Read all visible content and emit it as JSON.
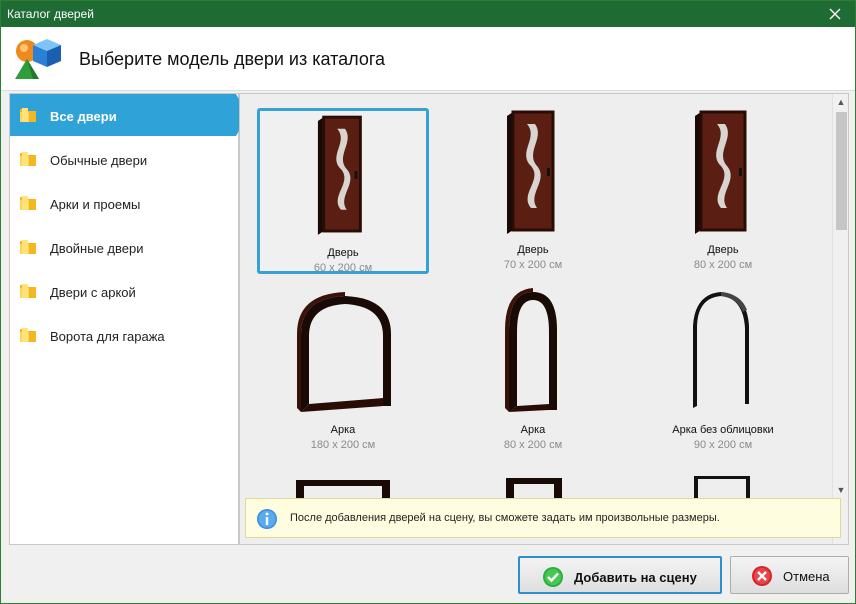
{
  "window": {
    "title": "Каталог дверей"
  },
  "header": {
    "title": "Выберите модель двери из каталога"
  },
  "sidebar": {
    "items": [
      {
        "label": "Все двери",
        "active": true
      },
      {
        "label": "Обычные двери"
      },
      {
        "label": "Арки и проемы"
      },
      {
        "label": "Двойные двери"
      },
      {
        "label": "Двери с аркой"
      },
      {
        "label": "Ворота для гаража"
      }
    ]
  },
  "catalog": {
    "items": [
      {
        "name": "Дверь",
        "size": "60 х 200 см",
        "kind": "door-icon",
        "selected": true
      },
      {
        "name": "Дверь",
        "size": "70 х 200 см",
        "kind": "door-icon"
      },
      {
        "name": "Дверь",
        "size": "80 х 200 см",
        "kind": "door-icon"
      },
      {
        "name": "Арка",
        "size": "180 х 200 см",
        "kind": "arch-icon"
      },
      {
        "name": "Арка",
        "size": "80 х 200 см",
        "kind": "arch-icon"
      },
      {
        "name": "Арка без облицовки",
        "size": "90 х 200 см",
        "kind": "arch-icon"
      }
    ]
  },
  "info": {
    "text": "После добавления дверей на сцену, вы сможете задать им произвольные размеры."
  },
  "buttons": {
    "add": "Добавить на сцену",
    "cancel": "Отмена"
  },
  "colors": {
    "titlebar": "#1e6b34",
    "accent": "#2fa3d8",
    "door": "#5a1f12",
    "info_bg": "#fffde0"
  }
}
